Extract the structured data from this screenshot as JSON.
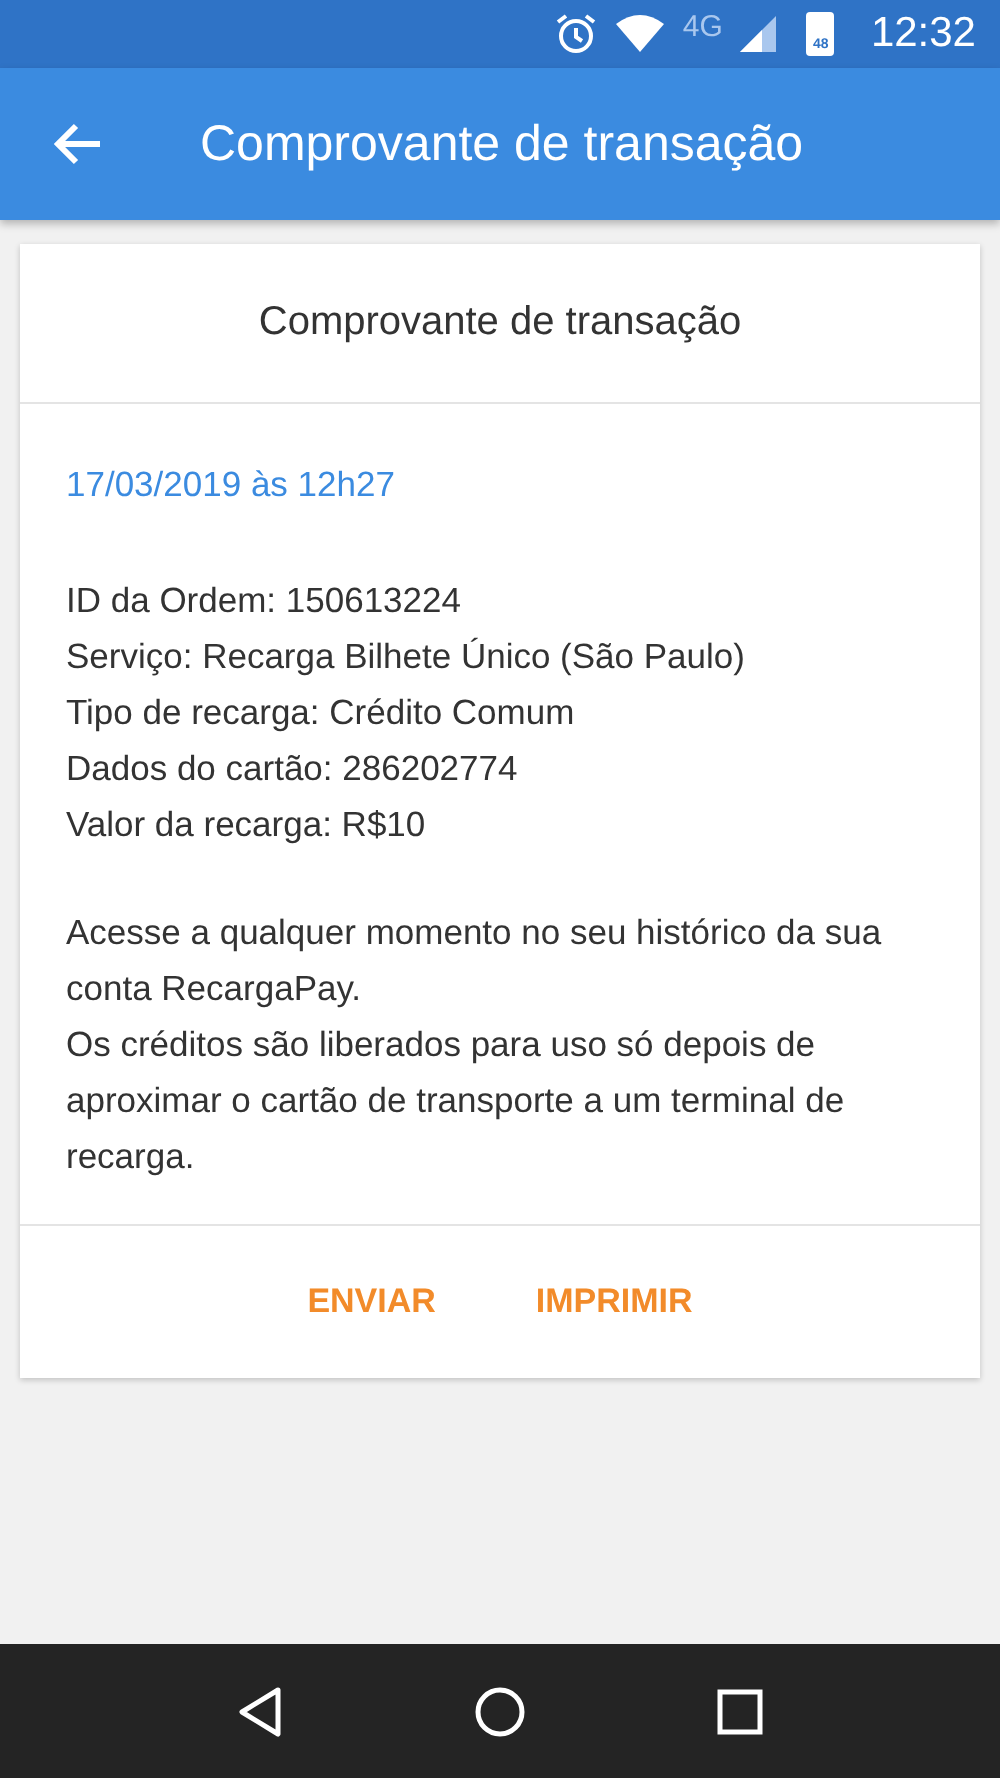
{
  "status_bar": {
    "network": "4G",
    "battery": "48",
    "time": "12:32"
  },
  "app_bar": {
    "title": "Comprovante de transação"
  },
  "card": {
    "title": "Comprovante de transação",
    "date": "17/03/2019 às 12h27",
    "details": [
      "ID da Ordem: 150613224",
      "Serviço: Recarga Bilhete Único (São Paulo)",
      "Tipo de recarga: Crédito Comum",
      "Dados do cartão: 286202774",
      "Valor da recarga: R$10"
    ],
    "notes": [
      "Acesse a qualquer momento no seu histórico da sua conta RecargaPay.",
      "Os créditos são liberados para uso só depois de aproximar o cartão de transporte a um terminal de recarga."
    ],
    "actions": [
      "ENVIAR",
      "IMPRIMIR"
    ]
  }
}
